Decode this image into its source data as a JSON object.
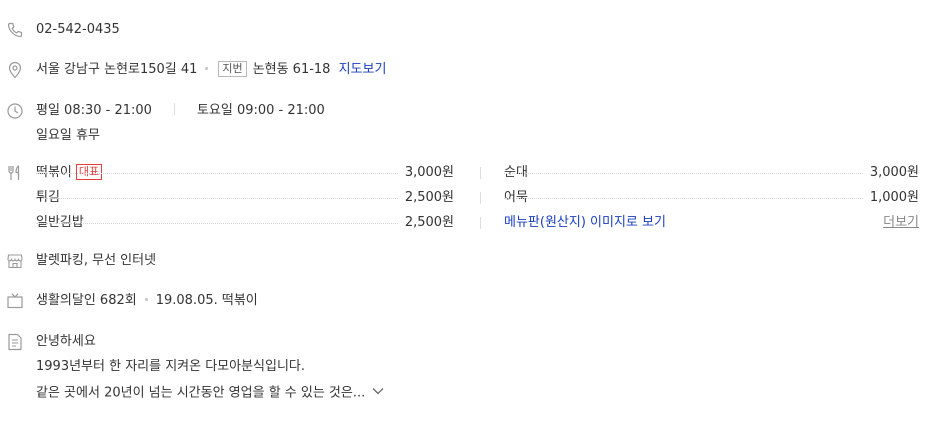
{
  "phone": {
    "icon": "phone-icon",
    "number": "02-542-0435"
  },
  "address": {
    "icon": "location-pin-icon",
    "road": "서울 강남구 논현로150길 41",
    "lot_tag": "지번",
    "lot": "논현동 61-18",
    "map_link": "지도보기"
  },
  "hours": {
    "icon": "clock-icon",
    "weekday": "평일 08:30 - 21:00",
    "saturday": "토요일 09:00 - 21:00",
    "sunday": "일요일 휴무"
  },
  "menu": {
    "icon": "utensils-icon",
    "rep_badge": "대표",
    "left": [
      {
        "name": "떡볶이",
        "price": "3,000원"
      },
      {
        "name": "튀김",
        "price": "2,500원"
      },
      {
        "name": "일반김밥",
        "price": "2,500원"
      }
    ],
    "right": [
      {
        "name": "순대",
        "price": "3,000원"
      },
      {
        "name": "어묵",
        "price": "1,000원"
      }
    ],
    "image_link": "메뉴판(원산지) 이미지로 보기",
    "more_link": "더보기"
  },
  "facilities": {
    "icon": "store-icon",
    "text": "발렛파킹, 무선 인터넷"
  },
  "tv": {
    "icon": "tv-icon",
    "program": "생활의달인 682회",
    "detail": "19.08.05. 떡볶이"
  },
  "intro": {
    "icon": "document-icon",
    "title": "안녕하세요",
    "line1": "1993년부터 한 자리를 지켜온 다모아분식입니다.",
    "line2": "같은 곳에서 20년이 넘는 시간동안 영업을 할 수 있는 것은..."
  },
  "colors": {
    "link": "#1a3fbf",
    "badge_red": "#e0403d",
    "icon_gray": "#999999"
  }
}
